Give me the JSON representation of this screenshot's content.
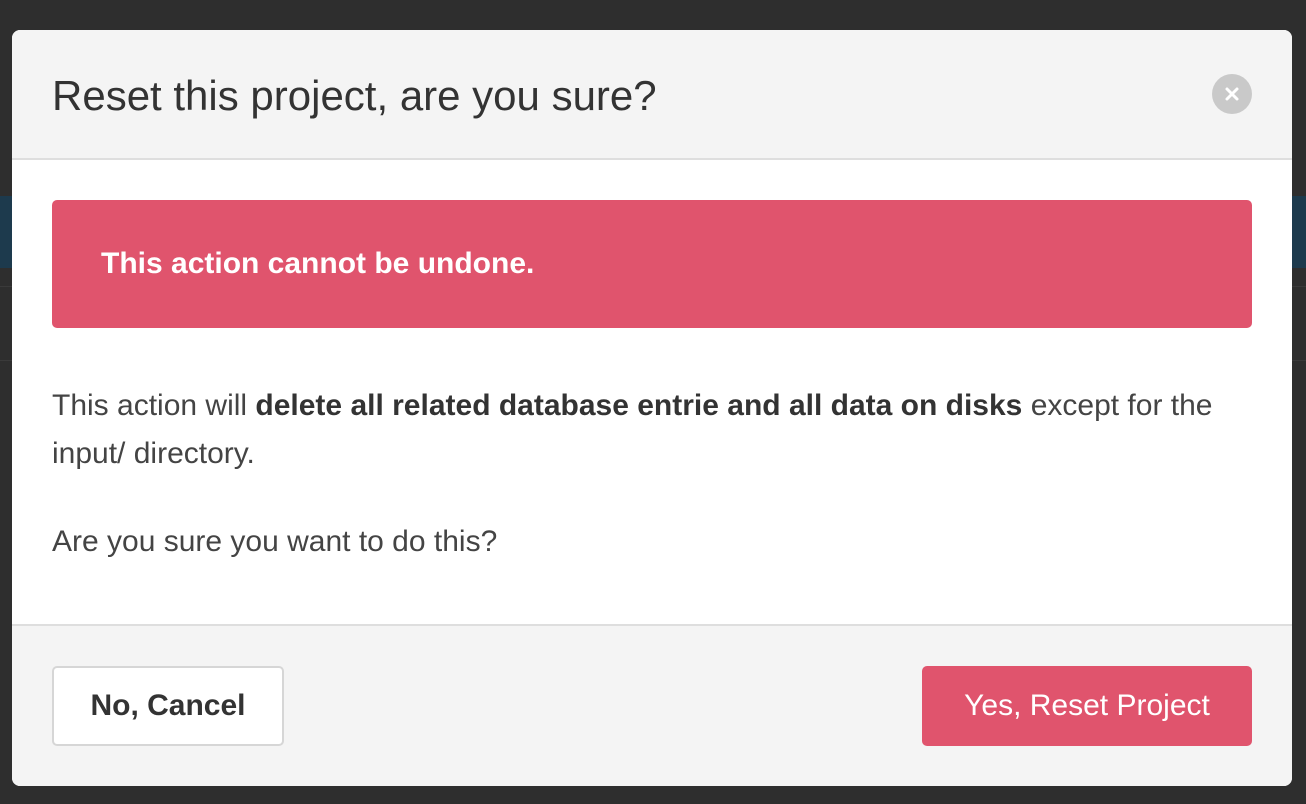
{
  "colors": {
    "danger": "#e0546d",
    "overlay": "#2e2e2e",
    "modal_header_bg": "#f4f4f4",
    "body_bg": "#ffffff",
    "text": "#333333"
  },
  "modal": {
    "title": "Reset this project, are you sure?",
    "close_icon": "close-icon",
    "alert": {
      "text": "This action cannot be undone."
    },
    "body": {
      "paragraph_prefix": "This action will ",
      "paragraph_bold": "delete all related database entrie and all data on disks",
      "paragraph_suffix": " except for the input/ directory.",
      "question": "Are you sure you want to do this?"
    },
    "footer": {
      "cancel_label": "No, Cancel",
      "confirm_label": "Yes, Reset Project"
    }
  }
}
